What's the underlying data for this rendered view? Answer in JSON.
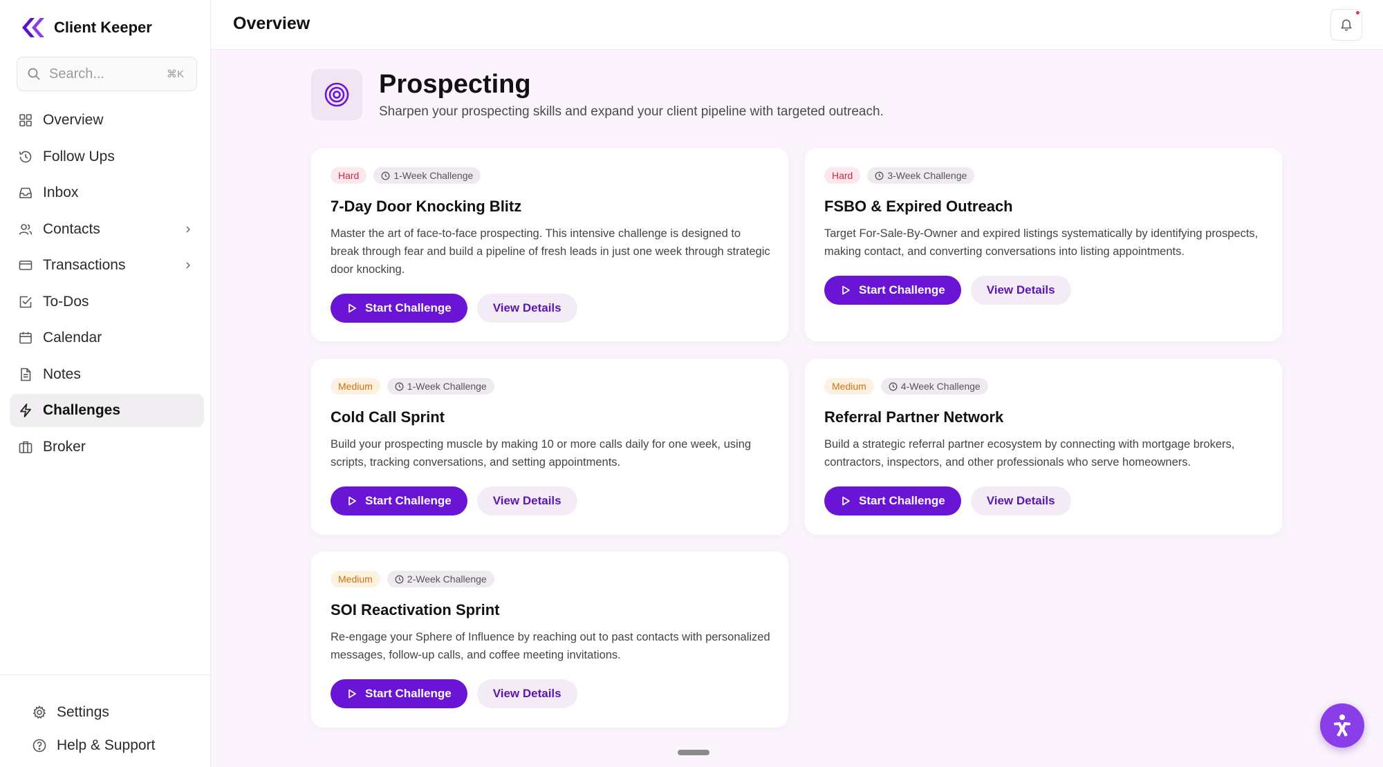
{
  "app": {
    "name": "Client Keeper",
    "page_title": "Overview"
  },
  "search": {
    "placeholder": "Search...",
    "shortcut": "⌘K"
  },
  "nav": [
    {
      "label": "Overview",
      "icon": "grid-icon"
    },
    {
      "label": "Follow Ups",
      "icon": "history-icon"
    },
    {
      "label": "Inbox",
      "icon": "inbox-icon"
    },
    {
      "label": "Contacts",
      "icon": "users-icon",
      "has_submenu": true
    },
    {
      "label": "Transactions",
      "icon": "credit-card-icon",
      "has_submenu": true
    },
    {
      "label": "To-Dos",
      "icon": "checkbox-icon"
    },
    {
      "label": "Calendar",
      "icon": "calendar-icon"
    },
    {
      "label": "Notes",
      "icon": "document-icon"
    },
    {
      "label": "Challenges",
      "icon": "lightning-icon",
      "active": true
    },
    {
      "label": "Broker",
      "icon": "briefcase-icon"
    }
  ],
  "bottom_nav": {
    "settings": "Settings",
    "help": "Help & Support"
  },
  "section": {
    "title": "Prospecting",
    "subtitle": "Sharpen your prospecting skills and expand your client pipeline with targeted outreach."
  },
  "colors": {
    "accent": "#6a14d6",
    "hard": "#c2294a",
    "medium": "#d0700c"
  },
  "challenges": [
    {
      "difficulty": "Hard",
      "duration": "1-Week Challenge",
      "title": "7-Day Door Knocking Blitz",
      "description": "Master the art of face-to-face prospecting. This intensive challenge is designed to break through fear and build a pipeline of fresh leads in just one week through strategic door knocking.",
      "start_label": "Start Challenge",
      "view_label": "View Details"
    },
    {
      "difficulty": "Hard",
      "duration": "3-Week Challenge",
      "title": "FSBO & Expired Outreach",
      "description": "Target For-Sale-By-Owner and expired listings systematically by identifying prospects, making contact, and converting conversations into listing appointments.",
      "start_label": "Start Challenge",
      "view_label": "View Details"
    },
    {
      "difficulty": "Medium",
      "duration": "1-Week Challenge",
      "title": "Cold Call Sprint",
      "description": "Build your prospecting muscle by making 10 or more calls daily for one week, using scripts, tracking conversations, and setting appointments.",
      "start_label": "Start Challenge",
      "view_label": "View Details"
    },
    {
      "difficulty": "Medium",
      "duration": "4-Week Challenge",
      "title": "Referral Partner Network",
      "description": "Build a strategic referral partner ecosystem by connecting with mortgage brokers, contractors, inspectors, and other professionals who serve homeowners.",
      "start_label": "Start Challenge",
      "view_label": "View Details"
    },
    {
      "difficulty": "Medium",
      "duration": "2-Week Challenge",
      "title": "SOI Reactivation Sprint",
      "description": "Re-engage your Sphere of Influence by reaching out to past contacts with personalized messages, follow-up calls, and coffee meeting invitations.",
      "start_label": "Start Challenge",
      "view_label": "View Details"
    }
  ]
}
